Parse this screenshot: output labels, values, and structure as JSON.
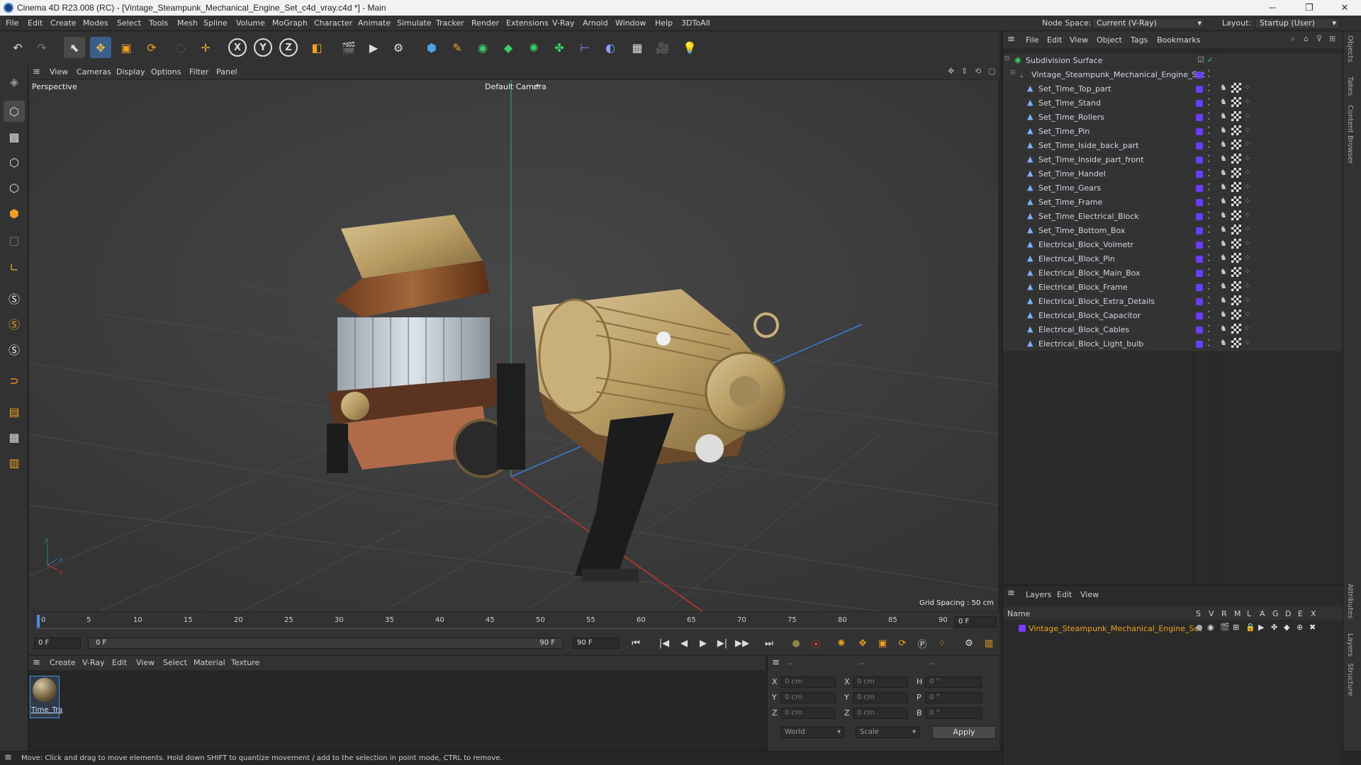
{
  "window": {
    "title": "Cinema 4D R23.008 (RC) - [Vintage_Steampunk_Mechanical_Engine_Set_c4d_vray.c4d *] - Main",
    "minimize": "─",
    "maximize": "❐",
    "close": "✕"
  },
  "menubar": {
    "items": [
      "File",
      "Edit",
      "Create",
      "Modes",
      "Select",
      "Tools",
      "Mesh",
      "Spline",
      "Volume",
      "MoGraph",
      "Character",
      "Animate",
      "Simulate",
      "Tracker",
      "Render",
      "Extensions",
      "V-Ray",
      "Arnold",
      "Window",
      "Help",
      "3DToAll"
    ],
    "node_space_label": "Node Space:",
    "node_space_value": "Current (V-Ray)",
    "layout_label": "Layout:",
    "layout_value": "Startup (User)"
  },
  "viewport": {
    "menu": [
      "View",
      "Cameras",
      "Display",
      "Options",
      "Filter",
      "Panel"
    ],
    "view_name": "Perspective",
    "camera": "Default Camera",
    "camera_suffix": ":*",
    "grid_spacing": "Grid Spacing : 50 cm"
  },
  "timeline": {
    "ticks": [
      "0",
      "5",
      "10",
      "15",
      "20",
      "25",
      "30",
      "35",
      "40",
      "45",
      "50",
      "55",
      "60",
      "65",
      "70",
      "75",
      "80",
      "85",
      "90"
    ],
    "end_frame_field": "0 F",
    "start_field": "0 F",
    "range_start": "0 F",
    "range_end": "90 F",
    "max_field": "90 F",
    "progress": 0.0
  },
  "materials": {
    "menu": [
      "Create",
      "V-Ray",
      "Edit",
      "View",
      "Select",
      "Material",
      "Texture"
    ],
    "items": [
      {
        "name": "Time_Tra"
      }
    ]
  },
  "coordinates": {
    "header": [
      "--",
      "--",
      "--"
    ],
    "rows": [
      {
        "a": "X",
        "av": "0 cm",
        "b": "X",
        "bv": "0 cm",
        "c": "H",
        "cv": "0 °"
      },
      {
        "a": "Y",
        "av": "0 cm",
        "b": "Y",
        "bv": "0 cm",
        "c": "P",
        "cv": "0 °"
      },
      {
        "a": "Z",
        "av": "0 cm",
        "b": "Z",
        "bv": "0 cm",
        "c": "B",
        "cv": "0 °"
      }
    ],
    "space": "World",
    "mode": "Scale",
    "apply": "Apply"
  },
  "status": "Move: Click and drag to move elements. Hold down SHIFT to quantize movement / add to the selection in point mode, CTRL to remove.",
  "objects": {
    "menu": [
      "File",
      "Edit",
      "View",
      "Object",
      "Tags",
      "Bookmarks"
    ],
    "root": "Subdivision Surface",
    "group": "Vintage_Steampunk_Mechanical_Engine_Set",
    "items": [
      "Set_Time_Top_part",
      "Set_Time_Stand",
      "Set_Time_Rollers",
      "Set_Time_Pin",
      "Set_Time_Iside_back_part",
      "Set_Time_Inside_part_front",
      "Set_Time_Handel",
      "Set_Time_Gears",
      "Set_Time_Frame",
      "Set_Time_Electrical_Block",
      "Set_Time_Bottom_Box",
      "Electrical_Block_Volmetr",
      "Electrical_Block_Pin",
      "Electrical_Block_Main_Box",
      "Electrical_Block_Frame",
      "Electrical_Block_Extra_Details",
      "Electrical_Block_Capacitor",
      "Electrical_Block_Cables",
      "Electrical_Block_Light_bulb"
    ]
  },
  "layers": {
    "menu": [
      "Layers",
      "Edit",
      "View"
    ],
    "name_header": "Name",
    "cols": [
      "S",
      "V",
      "R",
      "M",
      "L",
      "A",
      "G",
      "D",
      "E",
      "X"
    ],
    "item": "Vintage_Steampunk_Mechanical_Engine_Set",
    "layer_color": "#7a3cff"
  },
  "right_tabs": [
    "Objects",
    "Takes",
    "Content Browser",
    "Attributes",
    "Layers",
    "Structure"
  ],
  "colors": {
    "accent": "#4a8fe0",
    "object_color": "#6a3cff",
    "x_axis": "#c0392b",
    "z_axis": "#3a7bd5",
    "y_axis": "#2e8b57",
    "key_orange": "#f0a020"
  }
}
